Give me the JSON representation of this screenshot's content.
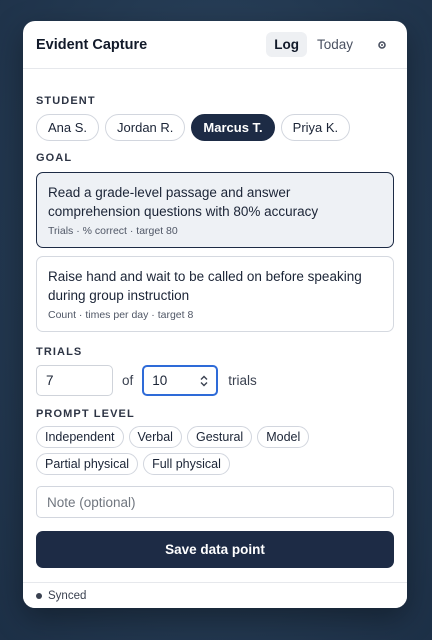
{
  "app": {
    "title": "Evident Capture"
  },
  "header": {
    "tabs": [
      {
        "label": "Log",
        "active": true
      },
      {
        "label": "Today",
        "active": false
      }
    ],
    "settings_icon": "gear-icon"
  },
  "student": {
    "label": "STUDENT",
    "options": [
      "Ana S.",
      "Jordan R.",
      "Marcus T.",
      "Priya K."
    ],
    "selected": "Marcus T."
  },
  "goal": {
    "label": "GOAL",
    "items": [
      {
        "title": "Read a grade-level passage and answer comprehension questions with 80% accuracy",
        "meta": "Trials · % correct · target 80",
        "selected": true
      },
      {
        "title": "Raise hand and wait to be called on before speaking during group instruction",
        "meta": "Count · times per day · target 8",
        "selected": false
      }
    ]
  },
  "trials": {
    "label": "TRIALS",
    "correct": "7",
    "of": "of",
    "total": "10",
    "unit": "trials"
  },
  "prompt": {
    "label": "PROMPT LEVEL",
    "options": [
      "Independent",
      "Verbal",
      "Gestural",
      "Model",
      "Partial physical",
      "Full physical"
    ]
  },
  "note": {
    "placeholder": "Note (optional)"
  },
  "save": {
    "label": "Save data point"
  },
  "status": {
    "text": "Synced"
  },
  "colors": {
    "primary": "#1d2b45",
    "focus": "#2e6bd8",
    "background": "#243a52"
  }
}
